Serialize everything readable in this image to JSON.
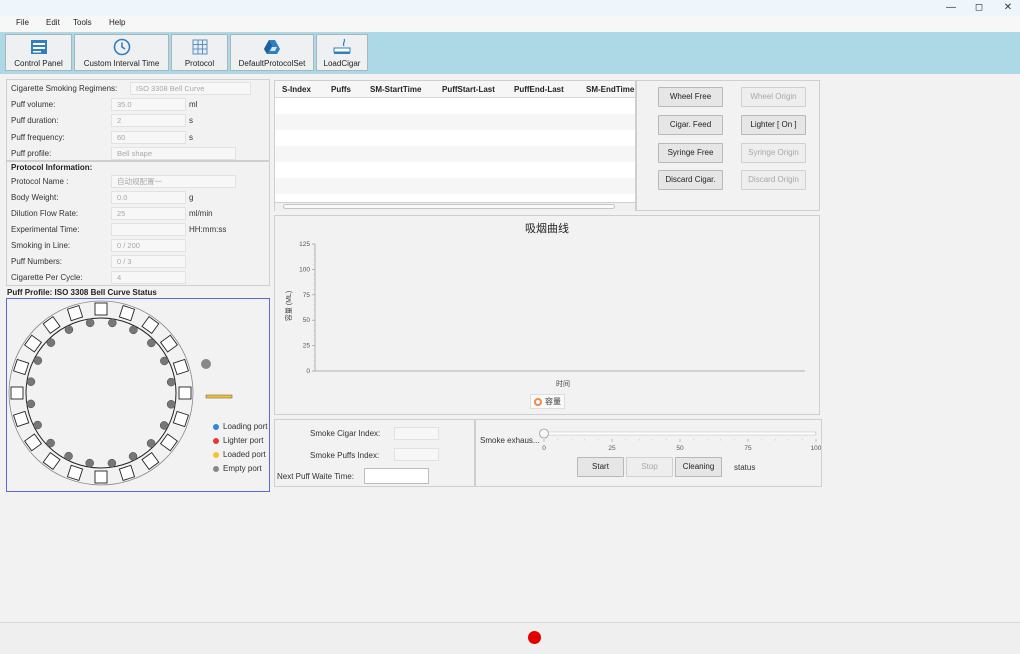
{
  "window": {
    "minimize": "—",
    "maximize": "◻",
    "close": "✕"
  },
  "menu": [
    "File",
    "Edit",
    "Tools",
    "Help"
  ],
  "toolbar": [
    {
      "label": "Control Panel",
      "icon": "control-panel-icon"
    },
    {
      "label": "Custom Interval Time",
      "icon": "clock-icon"
    },
    {
      "label": "Protocol",
      "icon": "grid-icon"
    },
    {
      "label": "DefaultProtocolSet",
      "icon": "drive-icon"
    },
    {
      "label": "LoadCigar",
      "icon": "cigar-icon"
    }
  ],
  "regimen": {
    "regimens_label": "Cigarette Smoking Regimens:",
    "regimens_value": "ISO 3308 Bell Curve",
    "rows": [
      {
        "label": "Puff volume:",
        "value": "35.0",
        "unit": "ml"
      },
      {
        "label": "Puff duration:",
        "value": "2",
        "unit": "s"
      },
      {
        "label": "Puff frequency:",
        "value": "60",
        "unit": "s"
      },
      {
        "label": "Puff profile:",
        "value": "Bell shape",
        "unit": ""
      }
    ]
  },
  "protocol": {
    "title": "Protocol Information:",
    "rows": [
      {
        "label": "Protocol Name :",
        "value": "自动规配置一",
        "unit": ""
      },
      {
        "label": "Body  Weight:",
        "value": "0.0",
        "unit": "g"
      },
      {
        "label": "Dilution Flow Rate:",
        "value": "25",
        "unit": "ml/min"
      },
      {
        "label": "Experimental Time:",
        "value": "",
        "unit": "HH:mm:ss"
      },
      {
        "label": "Smoking in Line:",
        "value": "0  /  200",
        "unit": ""
      },
      {
        "label": "Puff Numbers:",
        "value": "0  /  3",
        "unit": ""
      },
      {
        "label": "Cigarette Per Cycle:",
        "value": "4",
        "unit": ""
      }
    ]
  },
  "status_panel": {
    "title": "Puff Profile: ISO 3308 Bell Curve Status",
    "legend": [
      {
        "label": "Loading port",
        "color": "#2e86de"
      },
      {
        "label": "Lighter port",
        "color": "#e53935"
      },
      {
        "label": "Loaded port",
        "color": "#f4c430"
      },
      {
        "label": "Empty port",
        "color": "#888888"
      }
    ]
  },
  "table": {
    "columns": [
      "S-Index",
      "Puffs",
      "SM-StartTime",
      "PuffStart-Last",
      "PuffEnd-Last",
      "SM-EndTime"
    ],
    "rows": []
  },
  "controls": {
    "buttons": [
      {
        "label": "Wheel Free",
        "enabled": true
      },
      {
        "label": "Wheel Origin",
        "enabled": false
      },
      {
        "label": "Cigar. Feed",
        "enabled": true
      },
      {
        "label": "Lighter [ On ]",
        "enabled": true
      },
      {
        "label": "Syringe Free",
        "enabled": true
      },
      {
        "label": "Syringe Origin",
        "enabled": false
      },
      {
        "label": "Discard Cigar.",
        "enabled": true
      },
      {
        "label": "Discard Origin",
        "enabled": false
      }
    ]
  },
  "chart_data": {
    "type": "line",
    "title": "吸烟曲线",
    "xlabel": "时间",
    "ylabel": "容量 (ML)",
    "ylim": [
      0,
      125
    ],
    "yticks": [
      0,
      25,
      50,
      75,
      100,
      125
    ],
    "series": [
      {
        "name": "容量",
        "values": [],
        "color": "#f08a4b"
      }
    ]
  },
  "cigar_index": {
    "smoke_cigar_label": "Smoke Cigar Index:",
    "smoke_cigar_value": "",
    "smoke_puffs_label": "Smoke Puffs Index:",
    "smoke_puffs_value": "",
    "next_puff_label": "Next Puff Waite Time:",
    "next_puff_value": ""
  },
  "exhaust": {
    "label": "Smoke exhaus...",
    "value": 0,
    "ticks": [
      "0",
      "25",
      "50",
      "75",
      "100"
    ],
    "start": "Start",
    "stop": "Stop",
    "cleaning": "Cleaning",
    "status": "status"
  },
  "statusbar": {
    "indicator_color": "#e00000"
  }
}
